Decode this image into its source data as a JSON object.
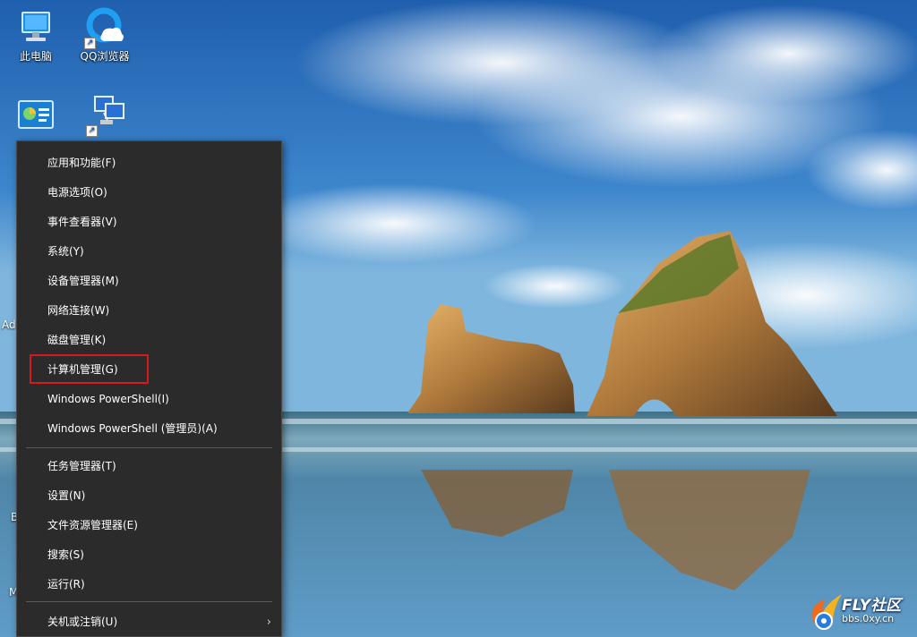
{
  "desktop": {
    "icons": [
      {
        "label": "此电脑",
        "icon": "this-pc-icon"
      },
      {
        "label": "QQ浏览器",
        "icon": "qq-browser-icon"
      },
      {
        "label": "",
        "icon": "control-panel-icon"
      },
      {
        "label": "",
        "icon": "network-icon"
      }
    ],
    "edge_text": {
      "ad": "Ad",
      "b": "B",
      "m": "M"
    }
  },
  "context_menu": {
    "groups": [
      [
        "应用和功能(F)",
        "电源选项(O)",
        "事件查看器(V)",
        "系统(Y)",
        "设备管理器(M)",
        "网络连接(W)",
        "磁盘管理(K)",
        "计算机管理(G)",
        "Windows PowerShell(I)",
        "Windows PowerShell (管理员)(A)"
      ],
      [
        "任务管理器(T)",
        "设置(N)",
        "文件资源管理器(E)",
        "搜索(S)",
        "运行(R)"
      ],
      [
        "关机或注销(U)"
      ]
    ],
    "highlighted_item": "计算机管理(G)",
    "highlight_color": "#d7191c",
    "submenu_icon": "chevron-right-icon"
  },
  "watermark": {
    "title": "FLY社区",
    "url": "bbs.0xy.cn"
  }
}
